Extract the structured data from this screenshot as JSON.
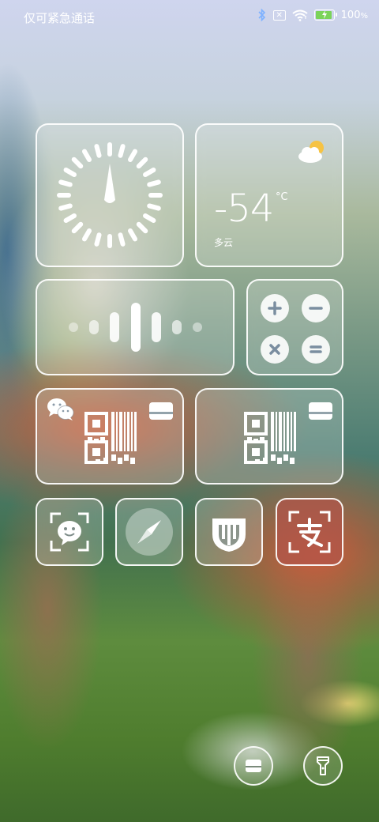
{
  "status_bar": {
    "carrier_text": "仅可紧急通话",
    "battery_percent": "100",
    "battery_unit": "%",
    "battery_level": 1.0,
    "icons": [
      "bluetooth-icon",
      "no-sim-icon",
      "wifi-icon",
      "battery-charging-icon"
    ]
  },
  "widgets": {
    "clock": {
      "icon": "compass-dial-icon"
    },
    "weather": {
      "temperature": "-54",
      "unit": "°C",
      "condition": "多云",
      "icon": "partly-cloudy-icon"
    },
    "voice": {
      "icon": "voice-waveform-icon"
    },
    "calculator": {
      "buttons": [
        "plus-icon",
        "minus-icon",
        "multiply-icon",
        "equals-icon"
      ]
    },
    "wechat_pay": {
      "icons": [
        "wechat-icon",
        "qr-barcode-icon",
        "card-icon"
      ]
    },
    "pay_code": {
      "icons": [
        "qr-barcode-icon",
        "card-icon"
      ]
    }
  },
  "apps": [
    {
      "name": "wechat-scan",
      "icon": "wechat-scan-icon"
    },
    {
      "name": "compass",
      "icon": "compass-icon"
    },
    {
      "name": "mi-home",
      "icon": "mi-home-icon"
    },
    {
      "name": "alipay-scan",
      "icon": "alipay-scan-icon"
    }
  ],
  "bottom_buttons": [
    {
      "icon": "wallet-card-icon"
    },
    {
      "icon": "flashlight-icon"
    }
  ],
  "colors": {
    "battery_fill": "#7bd35a",
    "alipay_tile": "#b0564a",
    "weather_sun": "#f6c343"
  }
}
